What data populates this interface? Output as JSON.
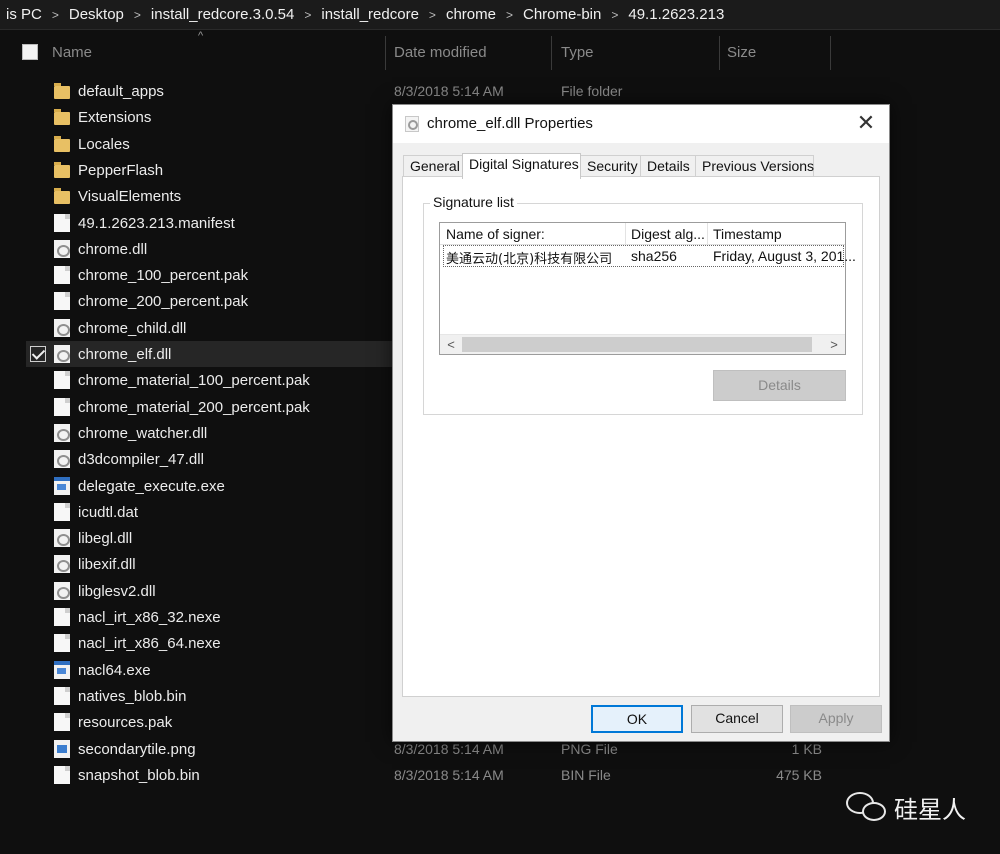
{
  "breadcrumb": [
    "is PC",
    "Desktop",
    "install_redcore.3.0.54",
    "install_redcore",
    "chrome",
    "Chrome-bin",
    "49.1.2623.213"
  ],
  "columns": {
    "name": "Name",
    "date": "Date modified",
    "type": "Type",
    "size": "Size"
  },
  "files": [
    {
      "name": "default_apps",
      "icon": "folder-icon",
      "date": "8/3/2018 5:14 AM",
      "type": "File folder",
      "size": ""
    },
    {
      "name": "Extensions",
      "icon": "folder-icon",
      "date": "",
      "type": "",
      "size": ""
    },
    {
      "name": "Locales",
      "icon": "folder-icon",
      "date": "",
      "type": "",
      "size": ""
    },
    {
      "name": "PepperFlash",
      "icon": "folder-icon",
      "date": "",
      "type": "",
      "size": ""
    },
    {
      "name": "VisualElements",
      "icon": "folder-icon",
      "date": "",
      "type": "",
      "size": ""
    },
    {
      "name": "49.1.2623.213.manifest",
      "icon": "file-icon",
      "date": "",
      "type": "",
      "size": ""
    },
    {
      "name": "chrome.dll",
      "icon": "dll-file-icon",
      "date": "",
      "type": "",
      "size": ""
    },
    {
      "name": "chrome_100_percent.pak",
      "icon": "file-icon",
      "date": "",
      "type": "",
      "size": ""
    },
    {
      "name": "chrome_200_percent.pak",
      "icon": "file-icon",
      "date": "",
      "type": "",
      "size": ""
    },
    {
      "name": "chrome_child.dll",
      "icon": "dll-file-icon",
      "date": "",
      "type": "",
      "size": ""
    },
    {
      "name": "chrome_elf.dll",
      "icon": "dll-file-icon",
      "date": "",
      "type": "",
      "size": "",
      "selected": true
    },
    {
      "name": "chrome_material_100_percent.pak",
      "icon": "file-icon",
      "date": "",
      "type": "",
      "size": ""
    },
    {
      "name": "chrome_material_200_percent.pak",
      "icon": "file-icon",
      "date": "",
      "type": "",
      "size": ""
    },
    {
      "name": "chrome_watcher.dll",
      "icon": "dll-file-icon",
      "date": "",
      "type": "",
      "size": ""
    },
    {
      "name": "d3dcompiler_47.dll",
      "icon": "dll-file-icon",
      "date": "",
      "type": "",
      "size": ""
    },
    {
      "name": "delegate_execute.exe",
      "icon": "exe-file-icon",
      "date": "",
      "type": "",
      "size": ""
    },
    {
      "name": "icudtl.dat",
      "icon": "file-icon",
      "date": "",
      "type": "",
      "size": ""
    },
    {
      "name": "libegl.dll",
      "icon": "dll-file-icon",
      "date": "",
      "type": "",
      "size": ""
    },
    {
      "name": "libexif.dll",
      "icon": "dll-file-icon",
      "date": "",
      "type": "",
      "size": ""
    },
    {
      "name": "libglesv2.dll",
      "icon": "dll-file-icon",
      "date": "",
      "type": "",
      "size": ""
    },
    {
      "name": "nacl_irt_x86_32.nexe",
      "icon": "file-icon",
      "date": "",
      "type": "",
      "size": ""
    },
    {
      "name": "nacl_irt_x86_64.nexe",
      "icon": "file-icon",
      "date": "",
      "type": "",
      "size": ""
    },
    {
      "name": "nacl64.exe",
      "icon": "exe-file-icon",
      "date": "",
      "type": "",
      "size": ""
    },
    {
      "name": "natives_blob.bin",
      "icon": "file-icon",
      "date": "",
      "type": "",
      "size": ""
    },
    {
      "name": "resources.pak",
      "icon": "file-icon",
      "date": "",
      "type": "",
      "size": ""
    },
    {
      "name": "secondarytile.png",
      "icon": "png-file-icon",
      "date": "8/3/2018 5:14 AM",
      "type": "PNG File",
      "size": "1 KB"
    },
    {
      "name": "snapshot_blob.bin",
      "icon": "file-icon",
      "date": "8/3/2018 5:14 AM",
      "type": "BIN File",
      "size": "475 KB"
    }
  ],
  "dialog": {
    "title": "chrome_elf.dll Properties",
    "close": "✕",
    "tabs": [
      "General",
      "Digital Signatures",
      "Security",
      "Details",
      "Previous Versions"
    ],
    "active_tab": "Digital Signatures",
    "group_label": "Signature list",
    "list_columns": [
      "Name of signer:",
      "Digest alg...",
      "Timestamp"
    ],
    "signatures": [
      {
        "signer": "美通云动(北京)科技有限公司",
        "digest": "sha256",
        "timestamp": "Friday, August 3, 201..."
      }
    ],
    "scroll_left": "<",
    "scroll_right": ">",
    "details_button": "Details",
    "ok": "OK",
    "cancel": "Cancel",
    "apply": "Apply"
  },
  "watermark": "硅星人"
}
